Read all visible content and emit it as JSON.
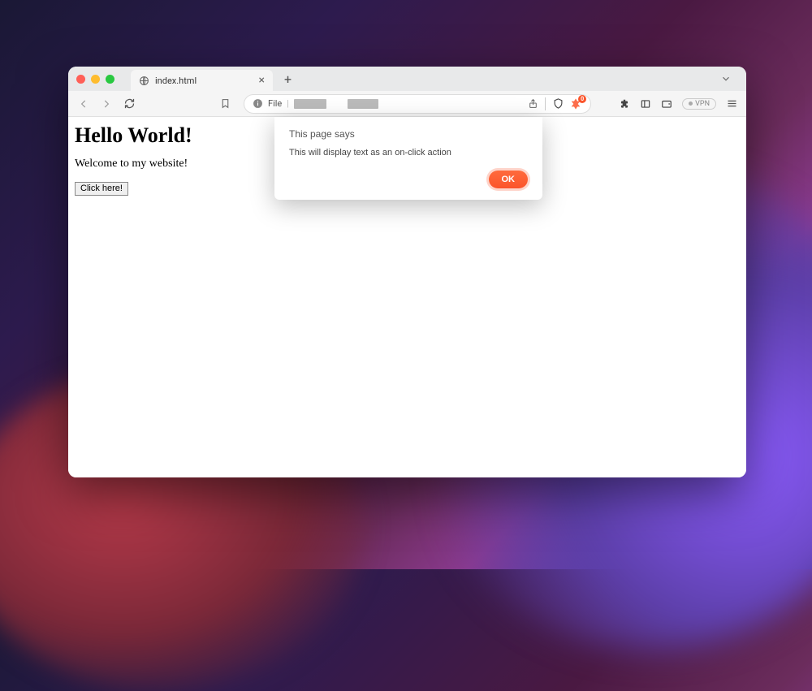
{
  "tab": {
    "title": "index.html"
  },
  "address": {
    "scheme_label": "File"
  },
  "toolbar": {
    "vpn_label": "VPN"
  },
  "brave": {
    "badge_count": "0"
  },
  "page": {
    "heading": "Hello World!",
    "paragraph": "Welcome to my website!",
    "button_label": "Click here!"
  },
  "dialog": {
    "title": "This page says",
    "message": "This will display text as an on-click action",
    "ok_label": "OK"
  }
}
